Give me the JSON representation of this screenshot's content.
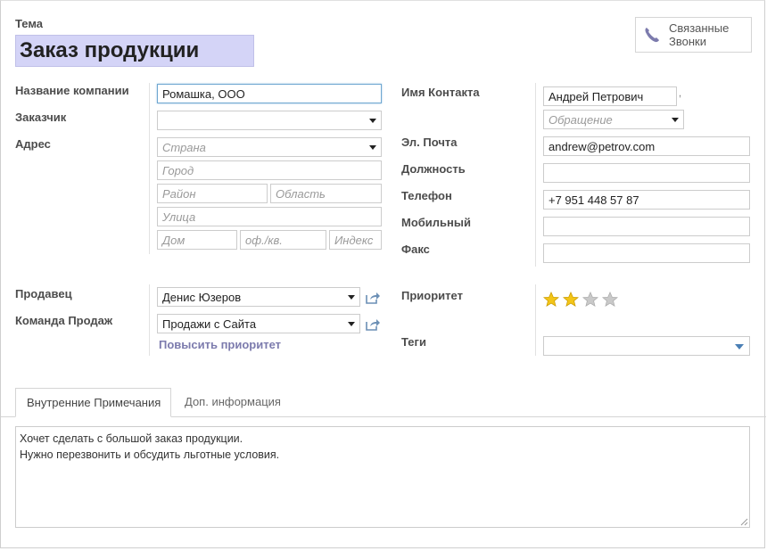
{
  "header": {
    "subject_label": "Тема",
    "title": "Заказ продукции",
    "related_calls_line1": "Связанные",
    "related_calls_line2": "Звонки"
  },
  "left": {
    "company_label": "Название компании",
    "company_value": "Ромашка, ООО",
    "customer_label": "Заказчик",
    "customer_value": "",
    "address_label": "Адрес",
    "country_ph": "Страна",
    "city_ph": "Город",
    "district_ph": "Район",
    "region_ph": "Область",
    "street_ph": "Улица",
    "house_ph": "Дом",
    "apt_ph": "оф./кв.",
    "zip_ph": "Индекс",
    "salesperson_label": "Продавец",
    "salesperson_value": "Денис Юзеров",
    "sales_team_label": "Команда Продаж",
    "sales_team_value": "Продажи с Сайта",
    "raise_priority_link": "Повысить приоритет"
  },
  "right": {
    "contact_label": "Имя Контакта",
    "contact_value": "Андрей Петрович",
    "title_ph": "Обращение",
    "email_label": "Эл. Почта",
    "email_value": "andrew@petrov.com",
    "position_label": "Должность",
    "phone_label": "Телефон",
    "phone_value": "+7 951 448 57 87",
    "mobile_label": "Мобильный",
    "fax_label": "Факс",
    "priority_label": "Приоритет",
    "priority_stars": 2,
    "priority_max": 4,
    "tags_label": "Теги"
  },
  "tabs": [
    {
      "label": "Внутренние Примечания",
      "active": true
    },
    {
      "label": "Доп. информация",
      "active": false
    }
  ],
  "notes": {
    "line1": "Хочет сделать с большой заказ продукции.",
    "line2": "Нужно перезвонить и обсудить льготные условия."
  },
  "colors": {
    "title_bg": "#d4d4f7",
    "link": "#7c7bad",
    "star_on": "#f3c518",
    "star_off": "#c9c9c9",
    "focus_border": "#6fa7d1"
  }
}
